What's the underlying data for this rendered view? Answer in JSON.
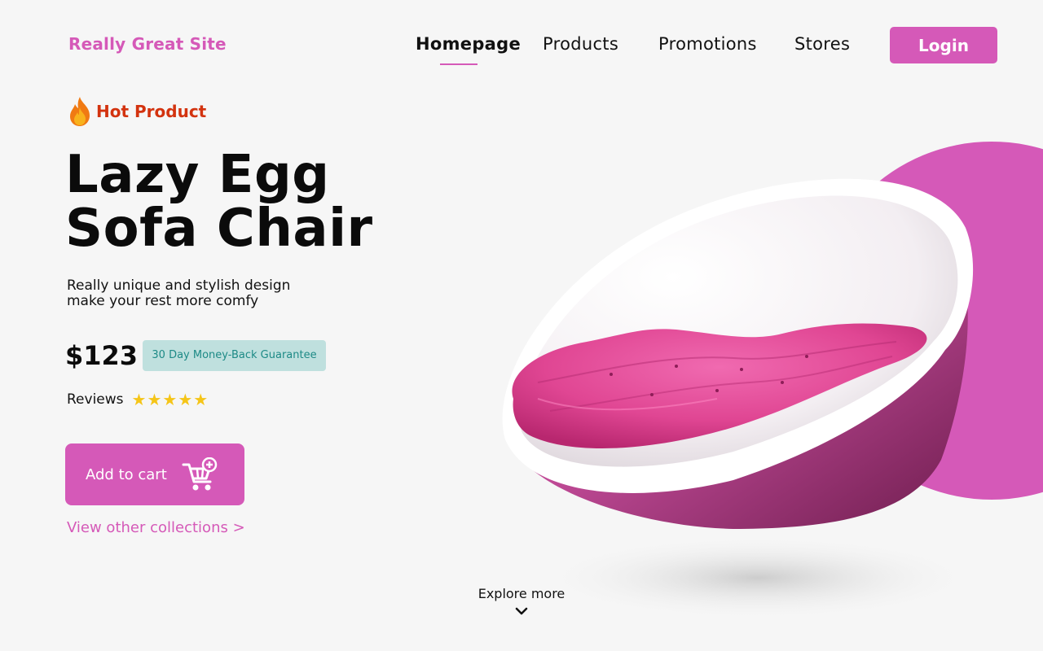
{
  "header": {
    "logo": "Really Great Site",
    "nav": [
      {
        "label": "Homepage",
        "active": true
      },
      {
        "label": "Products",
        "active": false
      },
      {
        "label": "Promotions",
        "active": false
      },
      {
        "label": "Stores",
        "active": false
      }
    ],
    "login_label": "Login"
  },
  "product": {
    "tag": "Hot Product",
    "title_line1": "Lazy Egg",
    "title_line2": "Sofa Chair",
    "desc_line1": "Really unique and stylish design",
    "desc_line2": "make your rest more comfy",
    "price": "$123",
    "guarantee": "30 Day Money-Back Guarantee",
    "reviews_label": "Reviews",
    "rating": 5,
    "rating_max": 5,
    "cart_label": "Add to cart",
    "collections_link": "View other collections >"
  },
  "footer": {
    "explore_label": "Explore more"
  },
  "colors": {
    "accent": "#d559b8",
    "hot": "#d3330f",
    "guarantee_bg": "#bfe0de",
    "guarantee_text": "#1d8a86",
    "star": "#f5c518",
    "background": "#f6f6f6"
  },
  "icons": [
    "fire-icon",
    "star-icon",
    "cart-plus-icon",
    "chevron-down-icon"
  ]
}
